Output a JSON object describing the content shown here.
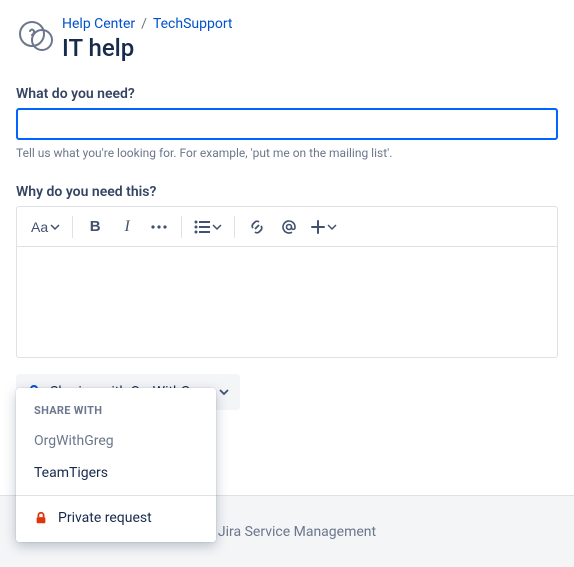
{
  "breadcrumb": {
    "help_center": "Help Center",
    "project": "TechSupport"
  },
  "title": "IT help",
  "summary": {
    "label": "What do you need?",
    "value": "",
    "hint": "Tell us what you're looking for. For example, 'put me on the mailing list'."
  },
  "description": {
    "label": "Why do you need this?"
  },
  "toolbar": {
    "text_styles": "Aa",
    "bold": "B",
    "italic": "I"
  },
  "share": {
    "current": "Sharing with OrgWithGreg",
    "header": "SHARE WITH",
    "options": {
      "org": "OrgWithGreg",
      "team": "TeamTigers",
      "private": "Private request"
    }
  },
  "footer": {
    "powered_by": "Jira Service Management"
  }
}
